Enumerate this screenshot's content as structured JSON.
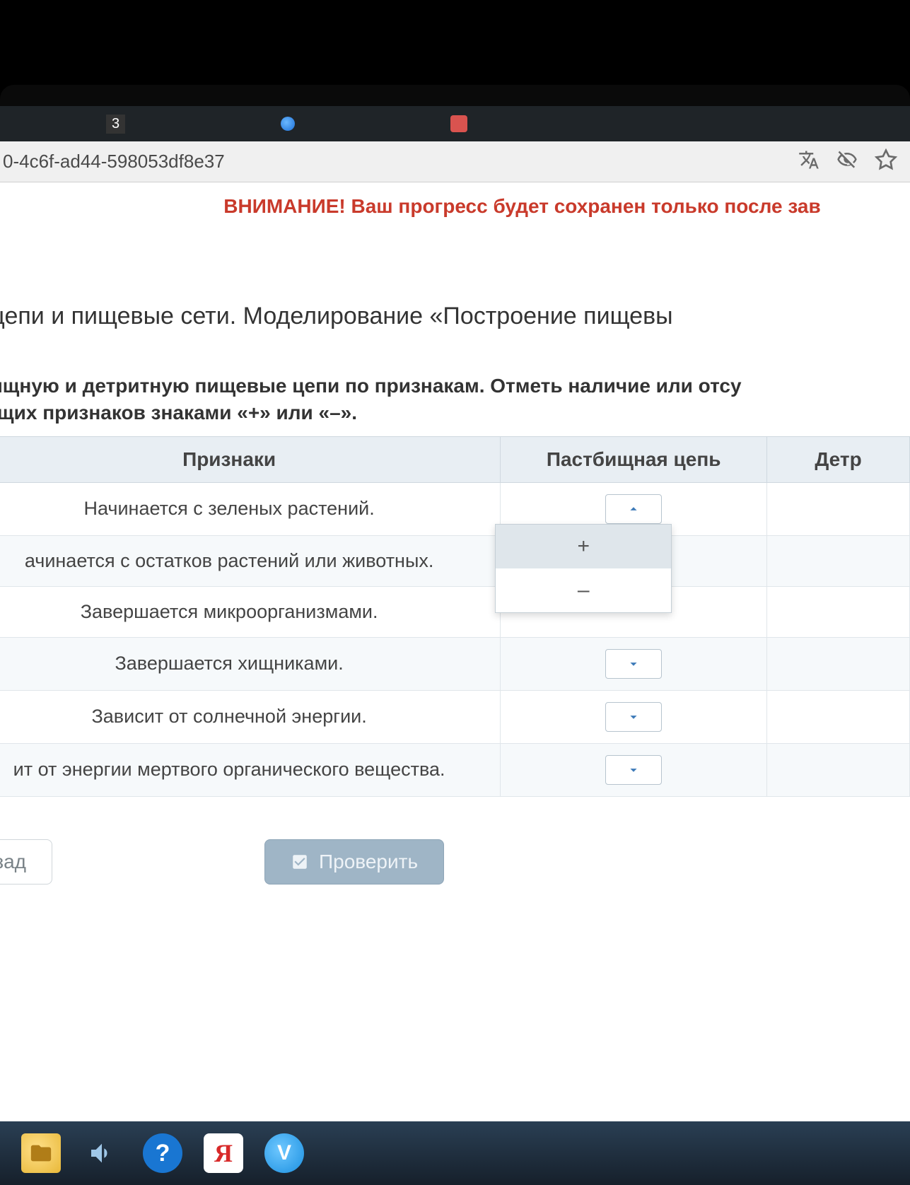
{
  "browser": {
    "tab_badge": "3",
    "url_fragment": "0-4c6f-ad44-598053df8e37"
  },
  "warning": "ВНИМАНИЕ! Ваш прогресс будет сохранен только после зав",
  "title": "ие цепи и пищевые сети. Моделирование «Построение пищевы",
  "instruction_line1": "стбищную и детритную пищевые цепи по признакам. Отметь наличие или отсу",
  "instruction_line2": "вующих признаков знаками «+» или «–».",
  "table": {
    "headers": {
      "features": "Признаки",
      "col1": "Пастбищная цепь",
      "col2": "Детр"
    },
    "rows": [
      {
        "feature": "Начинается с зеленых растений.",
        "open": true
      },
      {
        "feature": "ачинается с остатков растений или животных."
      },
      {
        "feature": "Завершается микроорганизмами."
      },
      {
        "feature": "Завершается хищниками."
      },
      {
        "feature": "Зависит от солнечной энергии."
      },
      {
        "feature": "ит от энергии мертвого органического вещества."
      }
    ]
  },
  "dropdown": {
    "options": [
      "+",
      "–"
    ]
  },
  "buttons": {
    "back": "азад",
    "check": "Проверить"
  },
  "taskbar": {
    "help": "?",
    "yandex": "Я",
    "v": "V"
  }
}
